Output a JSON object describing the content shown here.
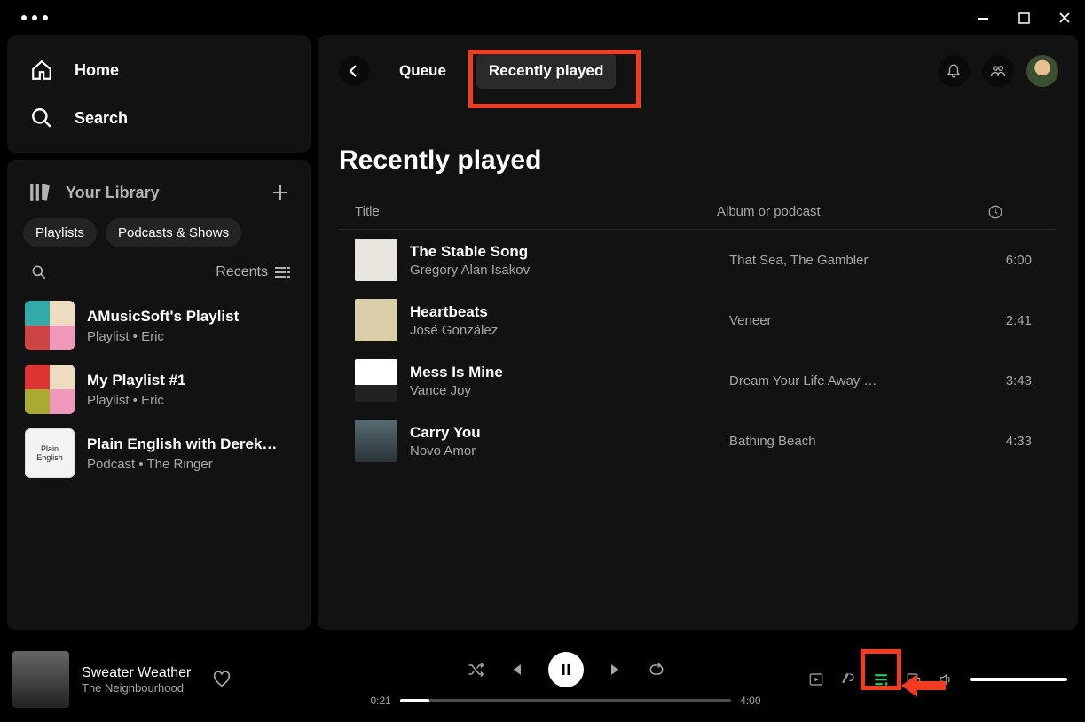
{
  "sidebar": {
    "home": "Home",
    "search": "Search",
    "library": "Your Library",
    "chips": [
      "Playlists",
      "Podcasts & Shows"
    ],
    "recents_label": "Recents",
    "items": [
      {
        "title": "AMusicSoft's Playlist",
        "sub": "Playlist • Eric"
      },
      {
        "title": "My Playlist #1",
        "sub": "Playlist • Eric"
      },
      {
        "title": "Plain English with Derek…",
        "sub": "Podcast • The Ringer"
      }
    ]
  },
  "header": {
    "tab_queue": "Queue",
    "tab_recently": "Recently played"
  },
  "page_title": "Recently played",
  "table": {
    "col_title": "Title",
    "col_album": "Album or podcast"
  },
  "tracks": [
    {
      "title": "The Stable Song",
      "artist": "Gregory Alan Isakov",
      "album": "That Sea, The Gambler",
      "duration": "6:00"
    },
    {
      "title": "Heartbeats",
      "artist": "José González",
      "album": "Veneer",
      "duration": "2:41"
    },
    {
      "title": "Mess Is Mine",
      "artist": "Vance Joy",
      "album": "Dream Your Life Away …",
      "duration": "3:43"
    },
    {
      "title": "Carry You",
      "artist": "Novo Amor",
      "album": "Bathing Beach",
      "duration": "4:33"
    }
  ],
  "now_playing": {
    "title": "Sweater Weather",
    "artist": "The Neighbourhood",
    "elapsed": "0:21",
    "total": "4:00"
  }
}
